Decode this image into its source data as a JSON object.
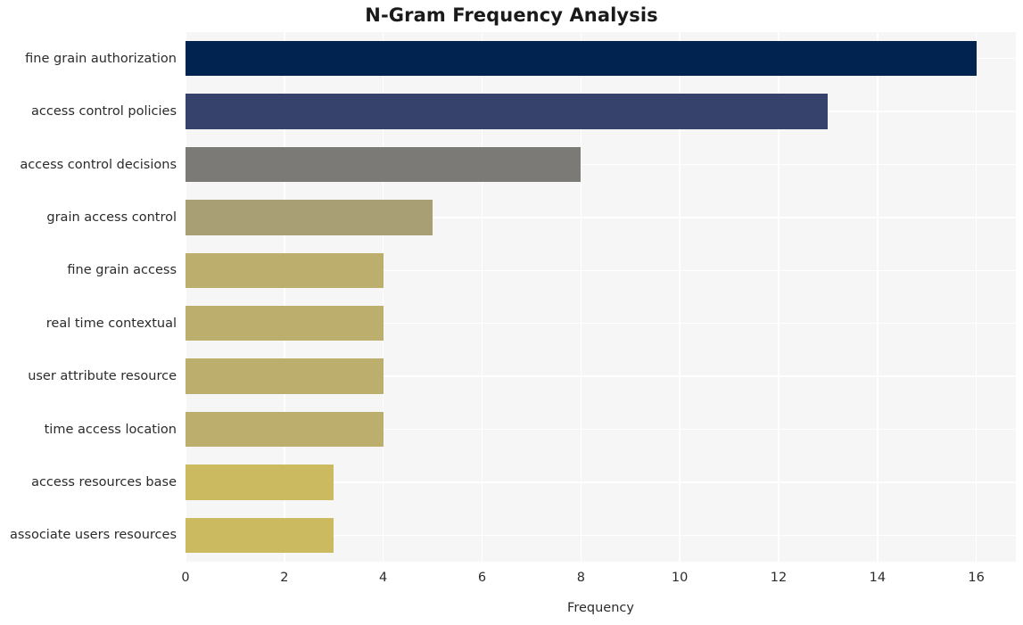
{
  "chart_data": {
    "type": "bar",
    "orientation": "horizontal",
    "title": "N-Gram Frequency Analysis",
    "xlabel": "Frequency",
    "ylabel": "",
    "categories": [
      "fine grain authorization",
      "access control policies",
      "access control decisions",
      "grain access control",
      "fine grain access",
      "real time contextual",
      "user attribute resource",
      "time access location",
      "access resources base",
      "associate users resources"
    ],
    "values": [
      16,
      13,
      8,
      5,
      4,
      4,
      4,
      4,
      3,
      3
    ],
    "bar_colors": [
      "#00234f",
      "#36426b",
      "#7b7a77",
      "#a99f74",
      "#bcae6d",
      "#bcae6d",
      "#bcae6d",
      "#bcae6d",
      "#cbba5f",
      "#cbba5f"
    ],
    "xlim": [
      0,
      16.8
    ],
    "xticks": [
      0,
      2,
      4,
      6,
      8,
      10,
      12,
      14,
      16
    ],
    "xtick_labels": [
      "0",
      "2",
      "4",
      "6",
      "8",
      "10",
      "12",
      "14",
      "16"
    ],
    "grid": true,
    "grid_color": "#ffffff",
    "plot_background": "#f6f6f7",
    "figure_background": "#ffffff",
    "legend": null,
    "text_color": "#2b2b2b"
  }
}
